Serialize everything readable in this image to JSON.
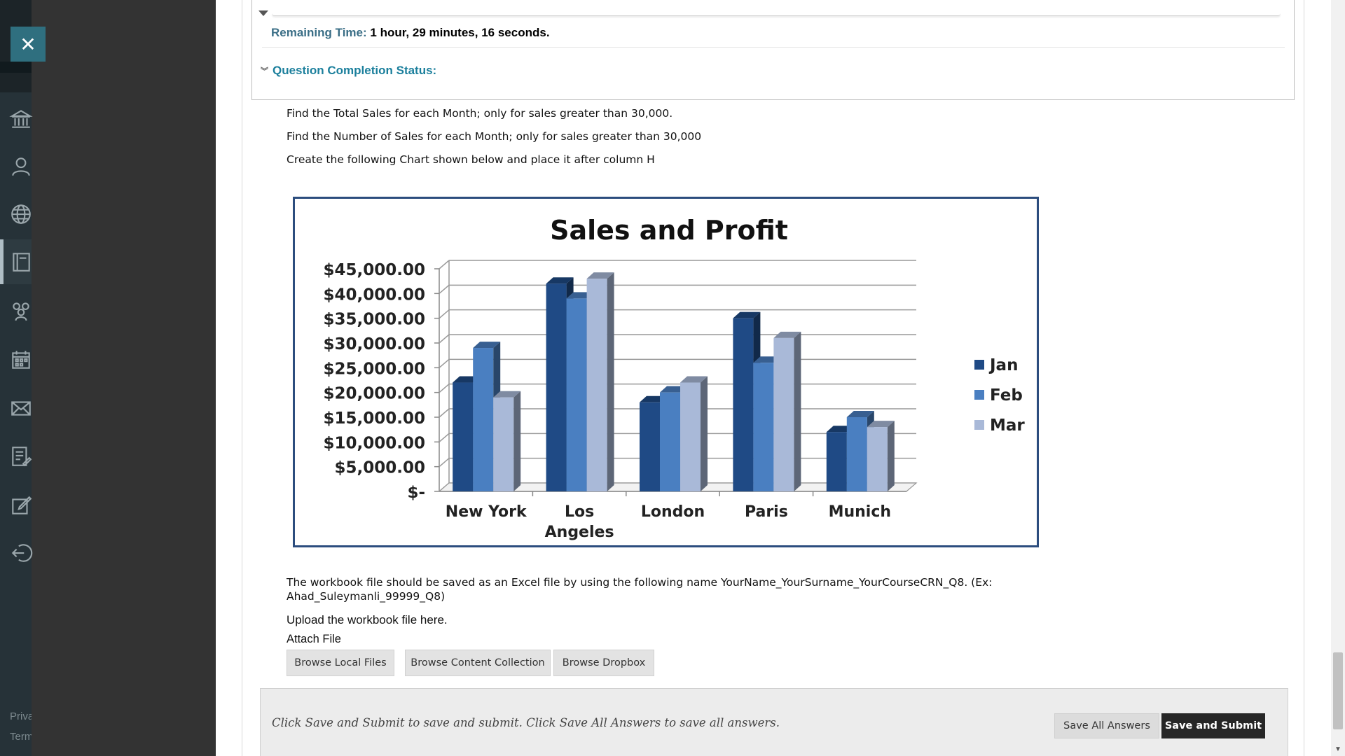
{
  "nav": {
    "close_label": "✕",
    "items": [
      {
        "icon": "institution-icon"
      },
      {
        "icon": "profile-icon"
      },
      {
        "icon": "globe-icon"
      },
      {
        "icon": "courses-icon"
      },
      {
        "icon": "groups-icon"
      },
      {
        "icon": "calendar-icon"
      },
      {
        "icon": "messages-icon"
      },
      {
        "icon": "grades-icon"
      },
      {
        "icon": "assignments-icon"
      },
      {
        "icon": "sign-out-icon"
      }
    ],
    "footer": {
      "privacy": "Privacy",
      "terms": "Terms"
    }
  },
  "timer": {
    "label": "Remaining Time:",
    "hours": "1",
    "hours_unit": "hour,",
    "minutes": "29",
    "minutes_unit": "minutes,",
    "seconds": "16",
    "seconds_unit": "seconds."
  },
  "completion": {
    "label": "Question Completion Status:"
  },
  "instructions": [
    "Find the Total Sales for each Month; only for sales greater than 30,000.",
    "Find the Number of Sales for each Month; only for sales greater than 30,000",
    "Create the following Chart shown below and place it after column H"
  ],
  "chart_data": {
    "type": "bar",
    "title": "Sales and Profit",
    "categories": [
      "New York",
      "Los Angeles",
      "London",
      "Paris",
      "Munich"
    ],
    "category_lines": [
      [
        "New York"
      ],
      [
        "Los",
        "Angeles"
      ],
      [
        "London"
      ],
      [
        "Paris"
      ],
      [
        "Munich"
      ]
    ],
    "series": [
      {
        "name": "Jan",
        "values": [
          22000,
          42000,
          18000,
          35000,
          12000
        ],
        "color": "#1f4a85"
      },
      {
        "name": "Feb",
        "values": [
          29000,
          39000,
          20000,
          26000,
          15000
        ],
        "color": "#4a7fc1"
      },
      {
        "name": "Mar",
        "values": [
          19000,
          43000,
          22000,
          31000,
          13000
        ],
        "color": "#a9b9d8"
      }
    ],
    "yticks": [
      "$-",
      "$5,000.00",
      "$10,000.00",
      "$15,000.00",
      "$20,000.00",
      "$25,000.00",
      "$30,000.00",
      "$35,000.00",
      "$40,000.00",
      "$45,000.00"
    ],
    "ylim": [
      0,
      45000
    ],
    "legend_position": "right",
    "grid": true
  },
  "file_note": {
    "line1": "The workbook file should be saved as an Excel file by using the following name YourName_YourSurname_YourCourseCRN_Q8. (Ex:",
    "line2": "Ahad_Suleymanli_99999_Q8)"
  },
  "upload_label": "Upload the workbook file here.",
  "attach_label": "Attach File",
  "buttons": {
    "browse_local": "Browse Local Files",
    "browse_content": "Browse Content Collection",
    "browse_dropbox": "Browse Dropbox",
    "save_all": "Save All Answers",
    "save_submit": "Save and Submit"
  },
  "submit_hint": "Click Save and Submit to save and submit. Click Save All Answers to save all answers."
}
